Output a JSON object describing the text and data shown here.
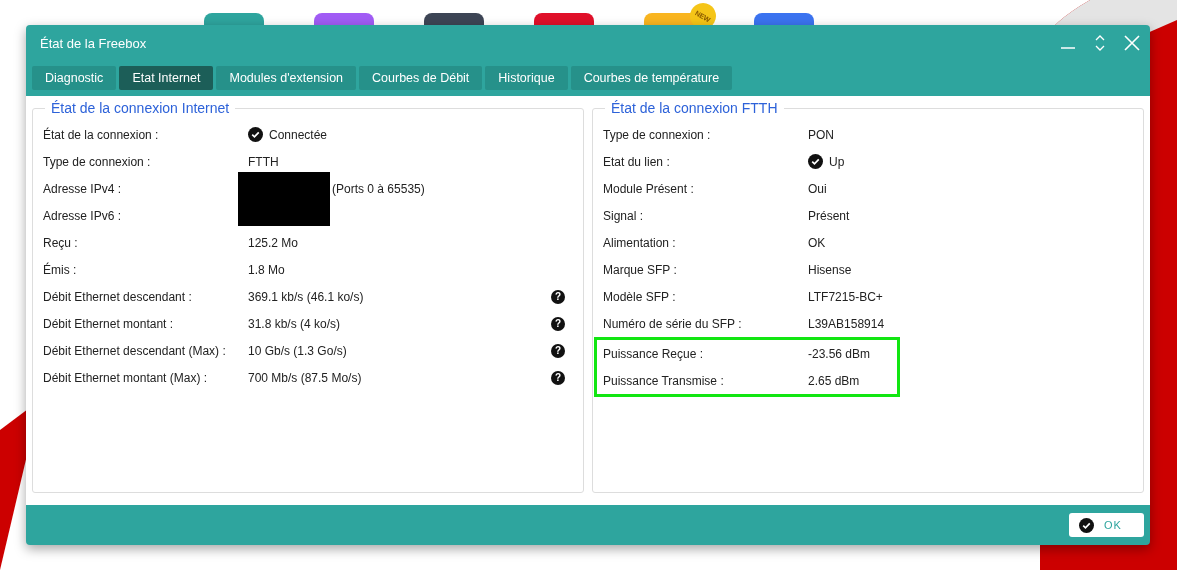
{
  "desktop": {
    "apps": [
      {
        "color": "#2ea59e"
      },
      {
        "color": "#a15cf5"
      },
      {
        "color": "#3d4555"
      },
      {
        "color": "#e0102a"
      },
      {
        "color": "#f9b520",
        "badge": "NEW"
      },
      {
        "color": "#3b73f0"
      }
    ]
  },
  "window": {
    "title": "État de la Freebox"
  },
  "tabs": [
    {
      "label": "Diagnostic",
      "selected": false
    },
    {
      "label": "Etat Internet",
      "selected": true
    },
    {
      "label": "Modules d'extension",
      "selected": false
    },
    {
      "label": "Courbes de Débit",
      "selected": false
    },
    {
      "label": "Historique",
      "selected": false
    },
    {
      "label": "Courbes de température",
      "selected": false
    }
  ],
  "panels": [
    {
      "title": "État de la connexion Internet",
      "rows": [
        {
          "label": "État de la connexion :",
          "value": "Connectée",
          "status_icon": true
        },
        {
          "label": "Type de connexion :",
          "value": "FTTH"
        },
        {
          "label": "Adresse IPv4 :",
          "value": "(Ports 0 à 65535)",
          "redacted": true
        },
        {
          "label": "Adresse IPv6 :"
        },
        {
          "label": "Reçu :",
          "value": "125.2 Mo"
        },
        {
          "label": "Émis :",
          "value": "1.8 Mo"
        },
        {
          "label": "Débit Ethernet descendant :",
          "value": "369.1 kb/s (46.1 ko/s)",
          "help": "?"
        },
        {
          "label": "Débit Ethernet montant :",
          "value": "31.8 kb/s (4 ko/s)",
          "help": "?"
        },
        {
          "label": "Débit Ethernet descendant (Max) :",
          "value": "10 Gb/s (1.3 Go/s)",
          "help": "?"
        },
        {
          "label": "Débit Ethernet montant (Max) :",
          "value": "700 Mb/s (87.5 Mo/s)",
          "help": "?"
        }
      ]
    },
    {
      "title": "État de la connexion FTTH",
      "rows": [
        {
          "label": "Type de connexion :",
          "value": "PON"
        },
        {
          "label": "Etat du lien :",
          "value": "Up",
          "status_icon": true
        },
        {
          "label": "Module Présent :",
          "value": "Oui"
        },
        {
          "label": "Signal :",
          "value": "Présent"
        },
        {
          "label": "Alimentation :",
          "value": "OK"
        },
        {
          "label": "Marque SFP :",
          "value": "Hisense"
        },
        {
          "label": "Modèle SFP :",
          "value": "LTF7215-BC+"
        },
        {
          "label": "Numéro de série du SFP :",
          "value": "L39AB158914"
        },
        {
          "label": "Puissance Reçue :",
          "value": "-23.56 dBm",
          "highlighted": true
        },
        {
          "label": "Puissance Transmise :",
          "value": "2.65 dBm",
          "highlighted": true
        }
      ]
    }
  ],
  "buttons": [
    {
      "label": "OK"
    }
  ]
}
